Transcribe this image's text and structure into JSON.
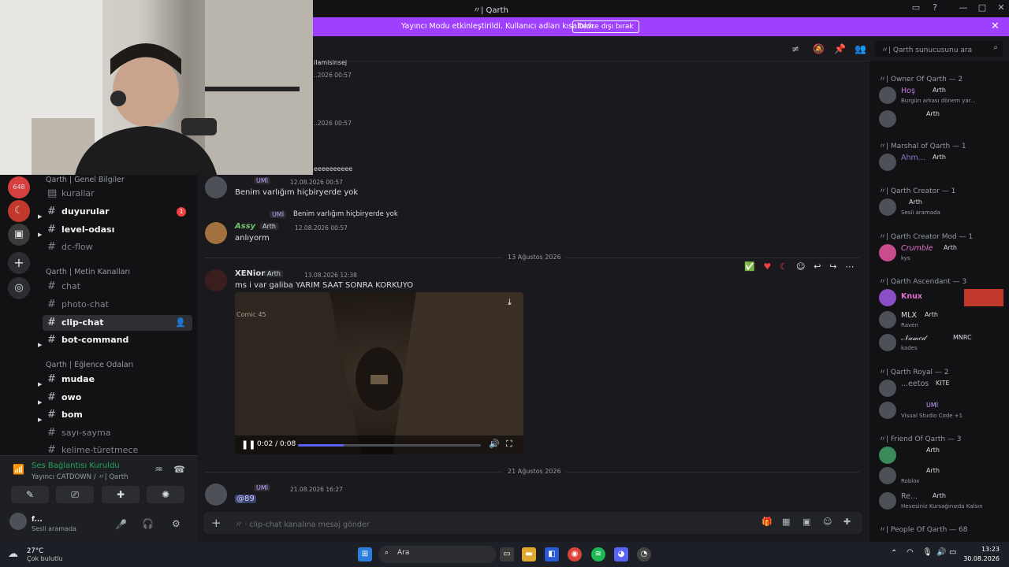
{
  "window": {
    "title": "〃| Qarth"
  },
  "banner": {
    "message": "Yayıncı Modu etkinleştirildi. Kullanıcı adları kısaltıldı.",
    "button": "Devre dışı bırak",
    "close": "✕"
  },
  "guild_rail": {
    "badge_count": "648"
  },
  "channels": {
    "categories": [
      {
        "name": "Qarth | Genel Bilgiler"
      },
      {
        "name": "Qarth | Metin Kanalları"
      },
      {
        "name": "Qarth | Eğlence Odaları"
      }
    ],
    "items": [
      {
        "name": "kurallar",
        "state": "read"
      },
      {
        "name": "duyurular",
        "state": "unread",
        "badge": "1"
      },
      {
        "name": "level-odası",
        "state": "unread"
      },
      {
        "name": "dc-flow",
        "state": "read"
      },
      {
        "name": "chat",
        "state": "read"
      },
      {
        "name": "photo-chat",
        "state": "read"
      },
      {
        "name": "clip-chat",
        "state": "active"
      },
      {
        "name": "bot-command",
        "state": "unread"
      },
      {
        "name": "mudae",
        "state": "unread"
      },
      {
        "name": "owo",
        "state": "unread"
      },
      {
        "name": "bom",
        "state": "unread"
      },
      {
        "name": "sayı-sayma",
        "state": "read"
      },
      {
        "name": "kelime-türetmece",
        "state": "read"
      }
    ]
  },
  "voice": {
    "status": "Ses Bağlantısı Kuruldu",
    "channel": "Yayıncı CATDOWN / 〃| Qarth",
    "user_name": "f...",
    "user_status": "Sesli aramada"
  },
  "header": {
    "search_placeholder": "〃| Qarth sunucusunu ara"
  },
  "messages": {
    "top_fragments": [
      {
        "text": "ilamisinsej",
        "time": "..2026 00:57"
      },
      {
        "time": "..2026 00:57"
      },
      {
        "text": "eeeeeeeeee"
      }
    ],
    "msg1": {
      "tag": "UMİ",
      "time": "12.08.2026 00:57",
      "text": "Benim varlığım hiçbiryerde yok"
    },
    "msg2": {
      "reply_tag": "UMİ",
      "reply_text": "Benim varlığım hiçbiryerde yok",
      "author": "Assy",
      "tag": "Arth",
      "time": "12.08.2026 00:57",
      "text": "anlıyorm"
    },
    "divider1": "13 Ağustos 2026",
    "msg3": {
      "author": "XENion",
      "tag": "Arth",
      "time": "13.08.2026 12:38",
      "text": "ms i var galiba YARIM SAAT SONRA KORKUYO"
    },
    "video": {
      "time": "0:02 / 0:08",
      "progress": 0.25,
      "overlay": "Comic 45"
    },
    "divider2": "21 Ağustos 2026",
    "msg4": {
      "tag": "UMİ",
      "time": "21.08.2026 16:27",
      "text": "@89"
    }
  },
  "composer": {
    "placeholder": "〃 · clip-chat kanalına mesaj gönder"
  },
  "members": {
    "groups": [
      {
        "role": "〃| Owner Of Qarth — 2",
        "members": [
          {
            "name": "Hoş",
            "tag": "Arth",
            "status": "Burgün arkası dönem yar..."
          },
          {
            "name": "",
            "tag": "Arth",
            "status": ""
          }
        ]
      },
      {
        "role": "〃| Marshal of Qarth — 1",
        "members": [
          {
            "name": "Ahm...",
            "tag": "Arth",
            "status": ""
          }
        ]
      },
      {
        "role": "〃| Qarth Creator — 1",
        "members": [
          {
            "name": "",
            "tag": "Arth",
            "status": "Sesli aramada"
          }
        ]
      },
      {
        "role": "〃| Qarth Creator Mod — 1",
        "members": [
          {
            "name": "Crumble",
            "tag": "Arth",
            "status": "kys"
          }
        ]
      },
      {
        "role": "〃| Qarth Ascendant — 3",
        "members": [
          {
            "name": "Knux",
            "tag": "",
            "status": ""
          },
          {
            "name": "MLX",
            "tag": "Arth",
            "status": "Raven"
          },
          {
            "name": "𝒩𝒶𝓂𝑒𝒹",
            "tag": "MNRC",
            "status": "kades"
          }
        ]
      },
      {
        "role": "〃| Qarth Royal — 2",
        "members": [
          {
            "name": "...eetos",
            "tag": "KITE",
            "status": ""
          },
          {
            "name": "",
            "tag": "UMİ",
            "status": "Visual Studio Code +1"
          }
        ]
      },
      {
        "role": "〃| Friend Of Qarth — 3",
        "members": [
          {
            "name": "",
            "tag": "Arth",
            "status": ""
          },
          {
            "name": "",
            "tag": "Arth",
            "status": "Roblox"
          },
          {
            "name": "Re...",
            "tag": "Arth",
            "status": "Hevesiniz Kursağınızda Kalsın"
          }
        ]
      },
      {
        "role": "〃| People Of Qarth — 68",
        "members": []
      }
    ]
  },
  "taskbar": {
    "weather_temp": "27°C",
    "weather_desc": "Çok bulutlu",
    "search": "Ara",
    "time": "13:23",
    "date": "30.08.2026"
  }
}
